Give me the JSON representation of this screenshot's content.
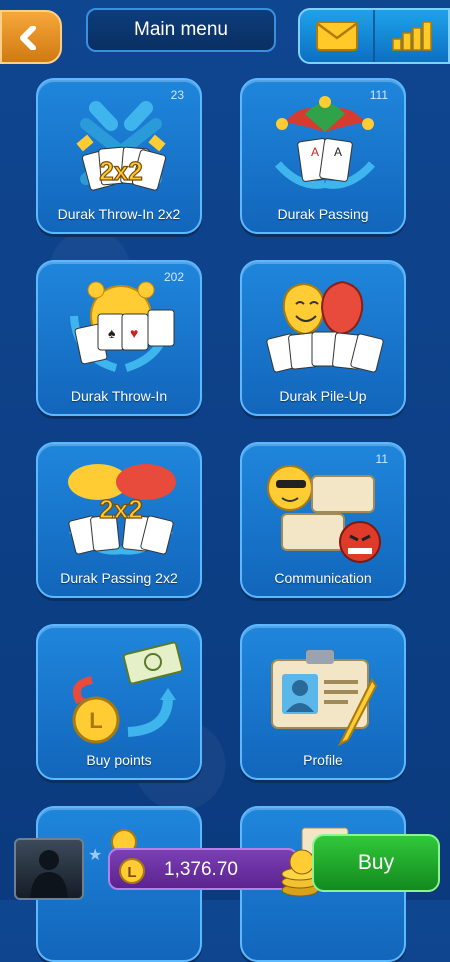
{
  "header": {
    "title": "Main menu",
    "back_icon": "back-arrow-icon",
    "mail_icon": "mail-icon",
    "stats_icon": "bar-chart-icon"
  },
  "tiles": [
    {
      "label": "Durak Throw-In 2x2",
      "count": "23",
      "badge": "2x2",
      "icon": "crossed-swords-cards-icon"
    },
    {
      "label": "Durak Passing",
      "count": "111",
      "icon": "jester-hat-cards-icon"
    },
    {
      "label": "Durak Throw-In",
      "count": "202",
      "icon": "alarm-clock-cards-icon"
    },
    {
      "label": "Durak Pile-Up",
      "count": "",
      "icon": "theatre-masks-cards-icon"
    },
    {
      "label": "Durak Passing 2x2",
      "count": "",
      "badge": "2x2",
      "icon": "hats-cards-icon"
    },
    {
      "label": "Communication",
      "count": "11",
      "icon": "chat-bubbles-icon"
    },
    {
      "label": "Buy points",
      "count": "",
      "icon": "coin-exchange-icon"
    },
    {
      "label": "Profile",
      "count": "",
      "icon": "id-card-icon"
    }
  ],
  "footer": {
    "points_value": "1,376.70",
    "buy_label": "Buy",
    "avatar_icon": "avatar-icon",
    "star_icon": "star-icon",
    "coin_icon": "l-coin-icon"
  },
  "colors": {
    "background": "#0d3c80",
    "tile": "#1a7bd2",
    "back_button": "#f6a73a",
    "buy_button": "#2bbb35",
    "points_pill": "#6c30a4"
  }
}
